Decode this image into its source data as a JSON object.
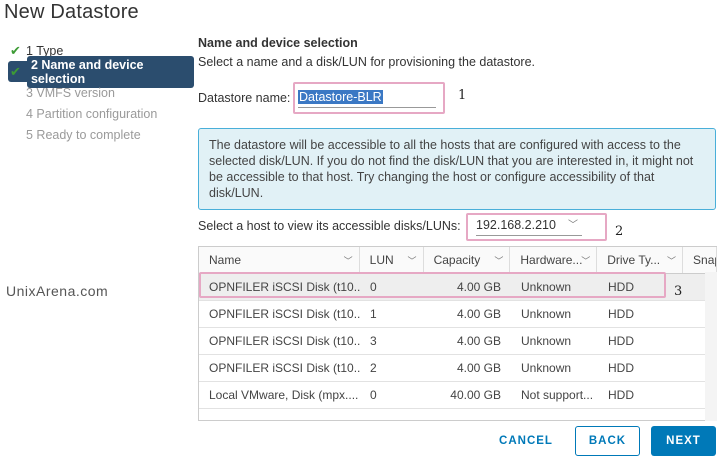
{
  "window": {
    "title": "New Datastore"
  },
  "steps": [
    {
      "label": "1 Type",
      "state": "done"
    },
    {
      "label": "2 Name and device selection",
      "state": "active"
    },
    {
      "label": "3 VMFS version",
      "state": "disabled"
    },
    {
      "label": "4 Partition configuration",
      "state": "disabled"
    },
    {
      "label": "5 Ready to complete",
      "state": "disabled"
    }
  ],
  "watermark": "UnixArena.com",
  "section": {
    "title": "Name and device selection",
    "subtitle": "Select a name and a disk/LUN for provisioning the datastore."
  },
  "datastore": {
    "label": "Datastore name:",
    "value": "Datastore-BLR"
  },
  "annotations": {
    "one": "1",
    "two": "2",
    "three": "3"
  },
  "info": "The datastore will be accessible to all the hosts that are configured with access to the selected disk/LUN. If you do not find the disk/LUN that you are interested in, it might not be accessible to that host. Try changing the host or configure accessibility of that disk/LUN.",
  "host": {
    "label": "Select a host to view its accessible disks/LUNs:",
    "value": "192.168.2.210"
  },
  "table": {
    "columns": [
      "Name",
      "LUN",
      "Capacity",
      "Hardware...",
      "Drive Ty...",
      "Snap"
    ],
    "rows": [
      {
        "name": "OPNFILER iSCSI Disk (t10....",
        "lun": "0",
        "capacity": "4.00 GB",
        "hardware": "Unknown",
        "drive": "HDD"
      },
      {
        "name": "OPNFILER iSCSI Disk (t10....",
        "lun": "1",
        "capacity": "4.00 GB",
        "hardware": "Unknown",
        "drive": "HDD"
      },
      {
        "name": "OPNFILER iSCSI Disk (t10....",
        "lun": "3",
        "capacity": "4.00 GB",
        "hardware": "Unknown",
        "drive": "HDD"
      },
      {
        "name": "OPNFILER iSCSI Disk (t10....",
        "lun": "2",
        "capacity": "4.00 GB",
        "hardware": "Unknown",
        "drive": "HDD"
      },
      {
        "name": "Local VMware, Disk (mpx....",
        "lun": "0",
        "capacity": "40.00 GB",
        "hardware": "Not support...",
        "drive": "HDD"
      }
    ]
  },
  "buttons": {
    "cancel": "CANCEL",
    "back": "BACK",
    "next": "NEXT"
  },
  "colors": {
    "accent": "#0079b8",
    "active_step": "#2b4d6e",
    "check": "#3d9b35",
    "info_bg": "#e1f1f6",
    "highlight_box": "#e6a8c4"
  }
}
